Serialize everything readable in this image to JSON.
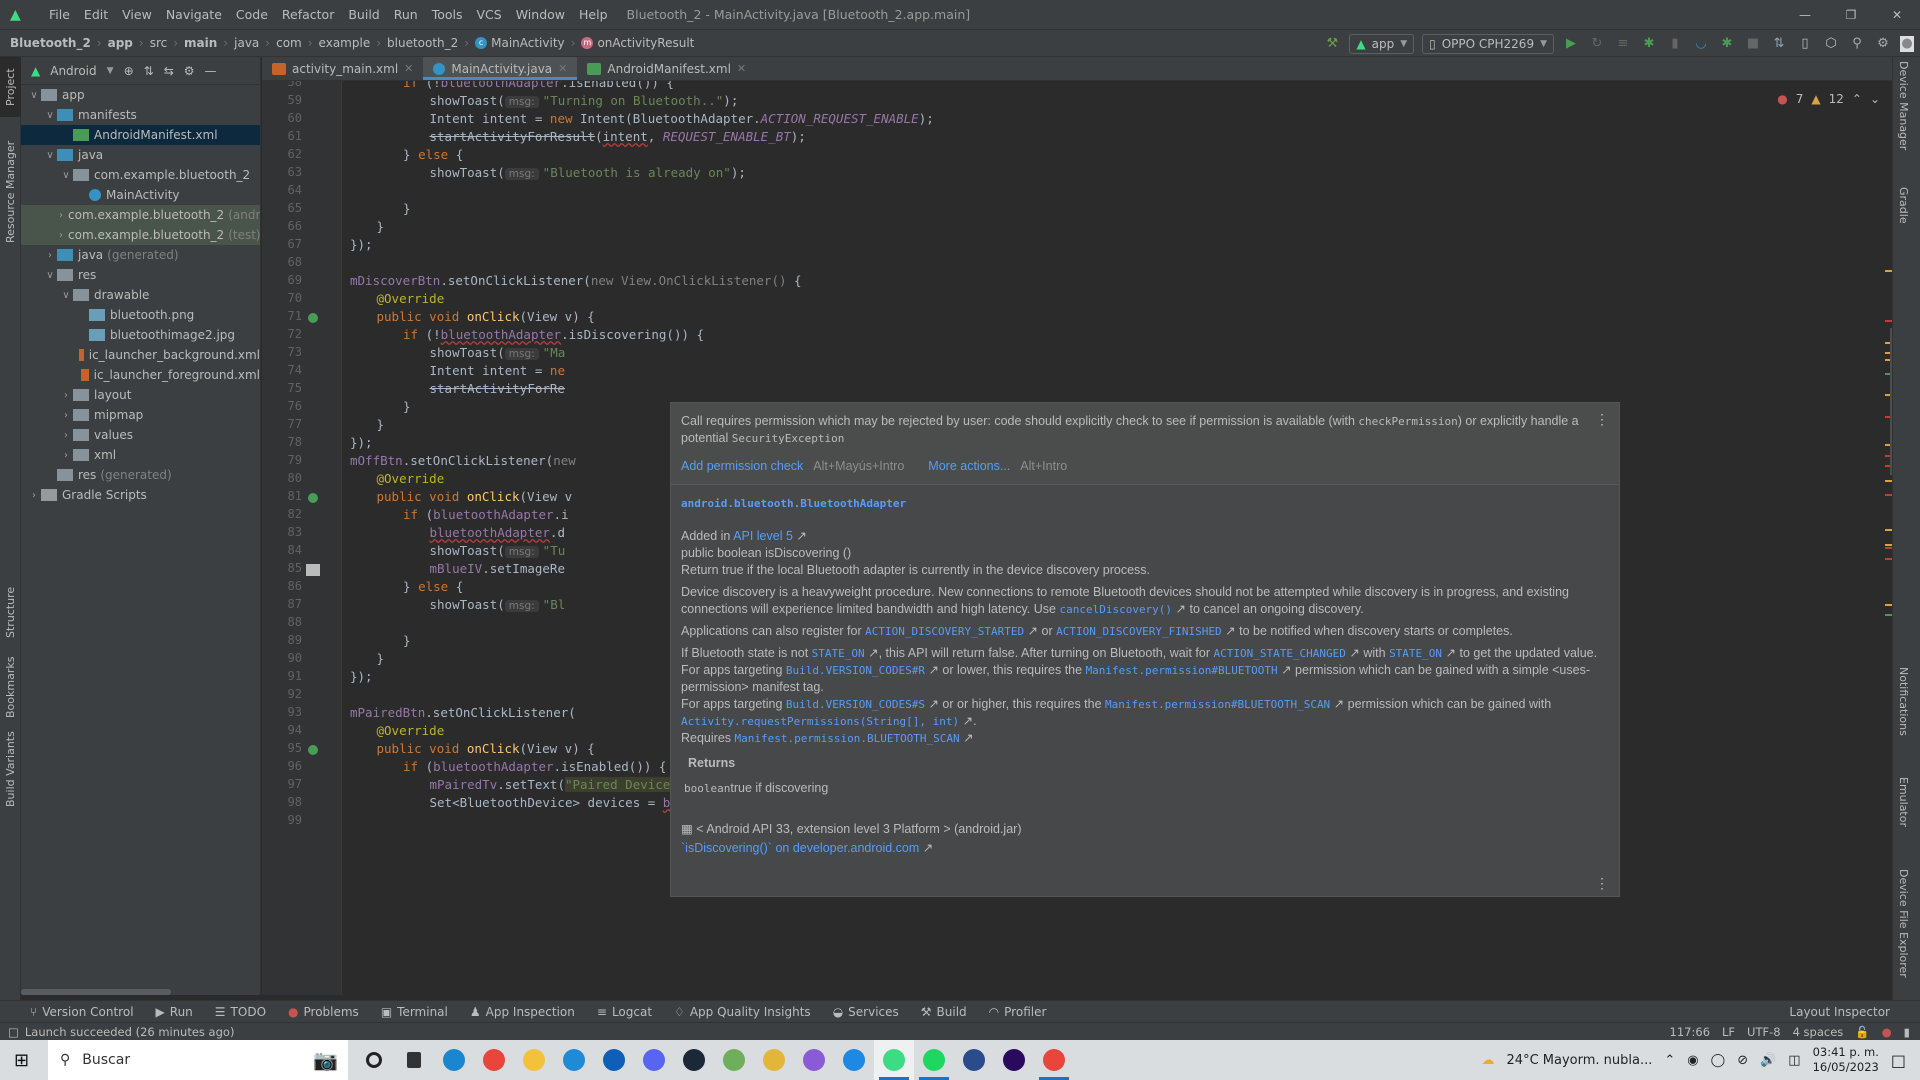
{
  "window": {
    "title": "Bluetooth_2 - MainActivity.java [Bluetooth_2.app.main]",
    "menu": [
      "File",
      "Edit",
      "View",
      "Navigate",
      "Code",
      "Refactor",
      "Build",
      "Run",
      "Tools",
      "VCS",
      "Window",
      "Help"
    ]
  },
  "breadcrumb": [
    "Bluetooth_2",
    "app",
    "src",
    "main",
    "java",
    "com",
    "example",
    "bluetooth_2",
    "MainActivity",
    "onActivityResult"
  ],
  "toolbar": {
    "run_config": "app",
    "device": "OPPO CPH2269"
  },
  "left_strip": [
    "Project",
    "Resource Manager",
    "Structure",
    "Bookmarks",
    "Build Variants"
  ],
  "right_strip": [
    "Device Manager",
    "Gradle",
    "Notifications",
    "Emulator",
    "Device File Explorer"
  ],
  "project_panel": {
    "view": "Android",
    "tree": [
      {
        "label": "app",
        "depth": 0,
        "expanded": true,
        "icon": "module-folder"
      },
      {
        "label": "manifests",
        "depth": 1,
        "expanded": true,
        "icon": "folder-blue"
      },
      {
        "label": "AndroidManifest.xml",
        "depth": 2,
        "icon": "manifest-file",
        "selected": true
      },
      {
        "label": "java",
        "depth": 1,
        "expanded": true,
        "icon": "folder-blue"
      },
      {
        "label": "com.example.bluetooth_2",
        "depth": 2,
        "expanded": true,
        "icon": "package"
      },
      {
        "label": "MainActivity",
        "depth": 3,
        "icon": "class"
      },
      {
        "label": "com.example.bluetooth_2",
        "suffix": "(androidTest)",
        "depth": 2,
        "expanded": false,
        "icon": "package",
        "test": true
      },
      {
        "label": "com.example.bluetooth_2",
        "suffix": "(test)",
        "depth": 2,
        "expanded": false,
        "icon": "package",
        "test": true
      },
      {
        "label": "java",
        "suffix": "(generated)",
        "depth": 1,
        "expanded": false,
        "icon": "folder-generated"
      },
      {
        "label": "res",
        "depth": 1,
        "expanded": true,
        "icon": "folder-res"
      },
      {
        "label": "drawable",
        "depth": 2,
        "expanded": true,
        "icon": "package"
      },
      {
        "label": "bluetooth.png",
        "depth": 3,
        "icon": "image-file"
      },
      {
        "label": "bluetoothimage2.jpg",
        "depth": 3,
        "icon": "image-file"
      },
      {
        "label": "ic_launcher_background.xml",
        "depth": 3,
        "icon": "xml-file"
      },
      {
        "label": "ic_launcher_foreground.xml",
        "depth": 3,
        "icon": "xml-file"
      },
      {
        "label": "layout",
        "depth": 2,
        "expanded": false,
        "icon": "package"
      },
      {
        "label": "mipmap",
        "depth": 2,
        "expanded": false,
        "icon": "package"
      },
      {
        "label": "values",
        "depth": 2,
        "expanded": false,
        "icon": "package"
      },
      {
        "label": "xml",
        "depth": 2,
        "expanded": false,
        "icon": "package"
      },
      {
        "label": "res",
        "suffix": "(generated)",
        "depth": 1,
        "icon": "folder-res"
      },
      {
        "label": "Gradle Scripts",
        "depth": 0,
        "expanded": false,
        "icon": "gradle"
      }
    ]
  },
  "editor_tabs": [
    {
      "label": "activity_main.xml",
      "icon": "xml-file"
    },
    {
      "label": "MainActivity.java",
      "icon": "class",
      "active": true
    },
    {
      "label": "AndroidManifest.xml",
      "icon": "manifest-file"
    }
  ],
  "inspections": {
    "errors": "7",
    "warnings": "12"
  },
  "code_lines": [
    {
      "n": "58",
      "html": "<span class='kw'>if</span> (!<span class='fld'>bluetoothAdapter</span>.isEnabled()) {",
      "indent": 6
    },
    {
      "n": "59",
      "html": "showToast(<span class='hint'>msg:</span><span class='str'>\"Turning on Bluetooth..\"</span>);",
      "indent": 7
    },
    {
      "n": "60",
      "html": "Intent intent = <span class='kw'>new</span> Intent(BluetoothAdapter.<span class='fld it'>ACTION_REQUEST_ENABLE</span>);",
      "indent": 7
    },
    {
      "n": "61",
      "html": "<span class='st'>startActivityForResult</span>(<span class='squig'>intent</span>, <span class='fld it'>REQUEST_ENABLE_BT</span>);",
      "indent": 7
    },
    {
      "n": "62",
      "html": "} <span class='kw'>else</span> {",
      "indent": 6
    },
    {
      "n": "63",
      "html": "showToast(<span class='hint'>msg:</span><span class='str'>\"Bluetooth is already on\"</span>);",
      "indent": 7
    },
    {
      "n": "64",
      "html": "",
      "indent": 7
    },
    {
      "n": "65",
      "html": "}",
      "indent": 6
    },
    {
      "n": "66",
      "html": "}",
      "indent": 5
    },
    {
      "n": "67",
      "html": "});",
      "indent": 4
    },
    {
      "n": "68",
      "html": "",
      "indent": 4
    },
    {
      "n": "69",
      "html": "<span class='fld'>mDiscoverBtn</span>.setOnClickListener(<span style='color:#808080'>new</span> <span style='color:#808080'>View.OnClickListener()</span> {",
      "indent": 4
    },
    {
      "n": "70",
      "html": "<span class='ann'>@Override</span>",
      "indent": 5
    },
    {
      "n": "71",
      "html": "<span class='kw'>public void</span> <span class='fn'>onClick</span>(View v) {",
      "indent": 5
    },
    {
      "n": "72",
      "html": "<span class='kw'>if</span> (!<span class='fld squig'>bluetoothAdapter</span>.isDiscovering()) {",
      "indent": 6
    },
    {
      "n": "73",
      "html": "showToast(<span class='hint'>msg:</span><span class='str'>\"Ma</span>",
      "indent": 7
    },
    {
      "n": "74",
      "html": "Intent intent = <span class='kw'>ne</span>",
      "indent": 7
    },
    {
      "n": "75",
      "html": "<span class='st'>startActivityForRe</span>",
      "indent": 7
    },
    {
      "n": "76",
      "html": "}",
      "indent": 6
    },
    {
      "n": "77",
      "html": "}",
      "indent": 5
    },
    {
      "n": "78",
      "html": "});",
      "indent": 4
    },
    {
      "n": "79",
      "html": "<span class='fld'>mOffBtn</span>.setOnClickListener(<span style='color:#808080'>new</span>",
      "indent": 4
    },
    {
      "n": "80",
      "html": "<span class='ann'>@Override</span>",
      "indent": 5
    },
    {
      "n": "81",
      "html": "<span class='kw'>public void</span> <span class='fn'>onClick</span>(View v",
      "indent": 5
    },
    {
      "n": "82",
      "html": "<span class='kw'>if</span> (<span class='fld'>bluetoothAdapter</span>.i",
      "indent": 6
    },
    {
      "n": "83",
      "html": "<span class='fld squig'>bluetoothAdapter</span>.d",
      "indent": 7
    },
    {
      "n": "84",
      "html": "showToast(<span class='hint'>msg:</span><span class='str'>\"Tu</span>",
      "indent": 7
    },
    {
      "n": "85",
      "html": "<span class='fld'>mBlueIV</span>.setImageRe",
      "indent": 7
    },
    {
      "n": "86",
      "html": "} <span class='kw'>else</span> {",
      "indent": 6
    },
    {
      "n": "87",
      "html": "showToast(<span class='hint'>msg:</span><span class='str'>\"Bl</span>",
      "indent": 7
    },
    {
      "n": "88",
      "html": "",
      "indent": 7
    },
    {
      "n": "89",
      "html": "}",
      "indent": 6
    },
    {
      "n": "90",
      "html": "}",
      "indent": 5
    },
    {
      "n": "91",
      "html": "});",
      "indent": 4
    },
    {
      "n": "92",
      "html": "",
      "indent": 4
    },
    {
      "n": "93",
      "html": "<span class='fld'>mPairedBtn</span>.setOnClickListener(",
      "indent": 4
    },
    {
      "n": "94",
      "html": "<span class='ann'>@Override</span>",
      "indent": 5
    },
    {
      "n": "95",
      "html": "<span class='kw'>public void</span> <span class='fn'>onClick</span>(View v) {",
      "indent": 5
    },
    {
      "n": "96",
      "html": "<span class='kw'>if</span> (<span class='fld'>bluetoothAdapter</span>.isEnabled()) {",
      "indent": 6
    },
    {
      "n": "97",
      "html": "<span class='fld'>mPairedTv</span>.setText(<span class='str hl'>\"Paired Devices\"</span>);",
      "indent": 7
    },
    {
      "n": "98",
      "html": "Set&lt;BluetoothDevice&gt; devices = <span class='fld squig'>bluetoothAdapter</span>.getBondedDevices();",
      "indent": 7
    },
    {
      "n": "99",
      "html": "",
      "indent": 7
    }
  ],
  "popup": {
    "warning_text_1": "Call requires permission which may be rejected by user: code should explicitly check to see if permission is available (with ",
    "warning_code_1": "checkPermission",
    "warning_text_2": ") or explicitly handle a potential ",
    "warning_code_2": "SecurityException",
    "action_primary": "Add permission check",
    "action_primary_shortcut": "Alt+Mayús+Intro",
    "action_more": "More actions...",
    "action_more_shortcut": "Alt+Intro",
    "class_name": "android.bluetooth.BluetoothAdapter",
    "added_in_prefix": "Added in ",
    "added_in_link": "API level 5",
    "signature": "public boolean isDiscovering ()",
    "summary": "Return true if the local Bluetooth adapter is currently in the device discovery process.",
    "para1": "Device discovery is a heavyweight procedure. New connections to remote Bluetooth devices should not be attempted while discovery is in progress, and existing connections will experience limited bandwidth and high latency. Use ",
    "para1_link": "cancelDiscovery()",
    "para1_end": " to cancel an ongoing discovery.",
    "para2_start": "Applications can also register for ",
    "para2_link1": "ACTION_DISCOVERY_STARTED",
    "para2_mid": " or ",
    "para2_link2": "ACTION_DISCOVERY_FINISHED",
    "para2_end": " to be notified when discovery starts or completes.",
    "para3_start": "If Bluetooth state is not ",
    "para3_link1": "STATE_ON",
    "para3_mid": ", this API will return false. After turning on Bluetooth, wait for ",
    "para3_link2": "ACTION_STATE_CHANGED",
    "para3_mid2": " with ",
    "para3_link3": "STATE_ON",
    "para3_end": " to get the updated value.",
    "para4_start": "For apps targeting ",
    "para4_link1": "Build.VERSION_CODES#R",
    "para4_mid": " or lower, this requires the ",
    "para4_link2": "Manifest.permission#BLUETOOTH",
    "para4_end": " permission which can be gained with a simple <uses-permission> manifest tag.",
    "para5_start": "For apps targeting ",
    "para5_link1": "Build.VERSION_CODES#S",
    "para5_mid": " or or higher, this requires the ",
    "para5_link2": "Manifest.permission#BLUETOOTH_SCAN",
    "para5_mid2": " permission which can be gained with ",
    "para5_link3": "Activity.requestPermissions(String[], int)",
    "para5_end": ".",
    "requires_prefix": "Requires ",
    "requires_link": "Manifest.permission.BLUETOOTH_SCAN",
    "returns_heading": "Returns",
    "returns_type": "boolean",
    "returns_text": "true if discovering",
    "library": "< Android API 33, extension level 3 Platform > (android.jar)",
    "external_link": "`isDiscovering()` on developer.android.com"
  },
  "tool_windows": [
    "Version Control",
    "Run",
    "TODO",
    "Problems",
    "Terminal",
    "App Inspection",
    "Logcat",
    "App Quality Insights",
    "Services",
    "Build",
    "Profiler"
  ],
  "layout_inspector": "Layout Inspector",
  "status": {
    "message": "Launch succeeded (26 minutes ago)",
    "position": "117:66",
    "line_sep": "LF",
    "encoding": "UTF-8",
    "indent": "4 spaces"
  },
  "taskbar": {
    "search_placeholder": "Buscar",
    "weather": "24°C  Mayorm. nubla...",
    "time": "03:41 p. m.",
    "date": "16/05/2023",
    "apps": [
      {
        "name": "cortana",
        "color": "#222222"
      },
      {
        "name": "task-view",
        "color": "#333333"
      },
      {
        "name": "edge",
        "color": "#1a86d0"
      },
      {
        "name": "chrome",
        "color": "#e8453c"
      },
      {
        "name": "file-explorer",
        "color": "#f4c13d"
      },
      {
        "name": "mail",
        "color": "#1f8bd6"
      },
      {
        "name": "store",
        "color": "#0f5fb8"
      },
      {
        "name": "discord",
        "color": "#5865f2"
      },
      {
        "name": "steam",
        "color": "#1b2838"
      },
      {
        "name": "hs-app",
        "color": "#6fae5a"
      },
      {
        "name": "dev-tool",
        "color": "#e3b53b"
      },
      {
        "name": "visual-studio",
        "color": "#8a5bd6"
      },
      {
        "name": "vscode",
        "color": "#1e88e5"
      },
      {
        "name": "android-studio",
        "color": "#3ddc84"
      },
      {
        "name": "spotify",
        "color": "#1ed760"
      },
      {
        "name": "cinema4d",
        "color": "#2a4b8c"
      },
      {
        "name": "premiere",
        "color": "#2a0a5e"
      },
      {
        "name": "chrome-profile",
        "color": "#e8453c"
      }
    ]
  }
}
